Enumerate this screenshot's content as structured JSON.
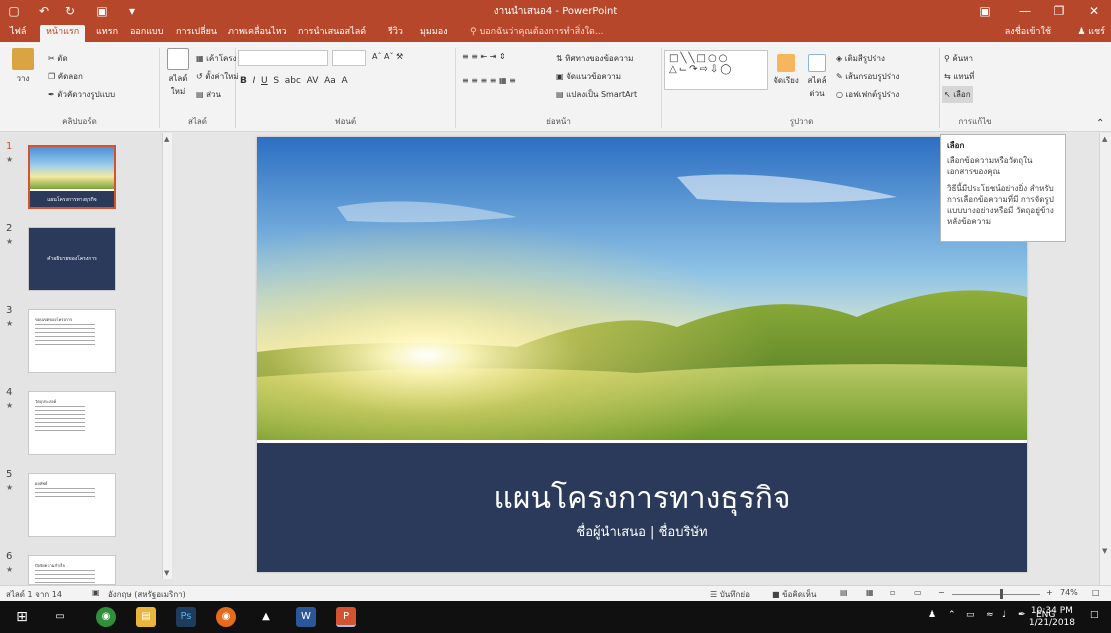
{
  "window": {
    "title": "งานนำเสนอ4 - PowerPoint",
    "save_icon": "save-icon",
    "undo_icon": "undo-icon",
    "redo_icon": "redo-icon",
    "brand_color": "#b7472a"
  },
  "tabs": [
    {
      "label": "ไฟล์"
    },
    {
      "label": "หน้าแรก",
      "active": true
    },
    {
      "label": "แทรก"
    },
    {
      "label": "ออกแบบ"
    },
    {
      "label": "การเปลี่ยน"
    },
    {
      "label": "ภาพเคลื่อนไหว"
    },
    {
      "label": "การนำเสนอสไลด์"
    },
    {
      "label": "รีวิว"
    },
    {
      "label": "มุมมอง"
    }
  ],
  "tell_me": "บอกฉันว่าคุณต้องการทำสิ่งใด...",
  "signin": "ลงชื่อเข้าใช้",
  "share": "แชร์",
  "ribbon": {
    "clipboard": {
      "paste": "วาง",
      "cut": "ตัด",
      "copy": "คัดลอก",
      "format_painter": "ตัวคัดวางรูปแบบ",
      "label": "คลิปบอร์ด"
    },
    "slides": {
      "new_slide": "สไลด์ใหม่",
      "layout": "เค้าโครง",
      "reset": "ตั้งค่าใหม่",
      "section": "ส่วน",
      "label": "สไลด์"
    },
    "font": {
      "label": "ฟอนต์"
    },
    "paragraph": {
      "text_direction": "ทิศทางของข้อความ",
      "align_text": "จัดแนวข้อความ",
      "smartart": "แปลงเป็น SmartArt",
      "label": "ย่อหน้า"
    },
    "drawing": {
      "arrange": "จัดเรียง",
      "quick_styles": "สไตล์ด่วน",
      "fill": "เติมสีรูปร่าง",
      "outline": "เส้นกรอบรูปร่าง",
      "effects": "เอฟเฟกต์รูปร่าง",
      "label": "รูปวาด"
    },
    "editing": {
      "find": "ค้นหา",
      "replace": "แทนที่",
      "select": "เลือก",
      "label": "การแก้ไข"
    }
  },
  "tooltip": {
    "title": "เลือก",
    "line1": "เลือกข้อความหรือวัตถุใน เอกสารของคุณ",
    "line2": "วิธีนี้มีประโยชน์อย่างยิ่ง สำหรับการเลือกข้อความที่มี การจัดรูปแบบบางอย่างหรือมี วัตถุอยู่ข้างหลังข้อความ"
  },
  "thumbnails": [
    {
      "num": "1",
      "selected": true,
      "title": "แผนโครงการทางธุรกิจ"
    },
    {
      "num": "2",
      "selected": false,
      "title": "คำอธิบายของโครงการ"
    },
    {
      "num": "3",
      "selected": false,
      "title": "ขอบเขตของโครงการ"
    },
    {
      "num": "4",
      "selected": false,
      "title": "วัตถุประสงค์"
    },
    {
      "num": "5",
      "selected": false,
      "title": "ผลลัพธ์"
    },
    {
      "num": "6",
      "selected": false,
      "title": "ปัจจัยความสำเร็จ"
    }
  ],
  "slide": {
    "title": "แผนโครงการทางธุรกิจ",
    "subtitle": "ชื่อผู้นำเสนอ | ชื่อบริษัท",
    "band_color": "#2b3a5b"
  },
  "status": {
    "slide_of": "สไลด์ 1 จาก 14",
    "language": "อังกฤษ (สหรัฐอเมริกา)",
    "notes": "บันทึกย่อ",
    "comments": "ข้อคิดเห็น",
    "zoom": "74%"
  },
  "taskbar": {
    "lang": "ENG",
    "time": "10:34 PM",
    "date": "1/21/2018"
  }
}
